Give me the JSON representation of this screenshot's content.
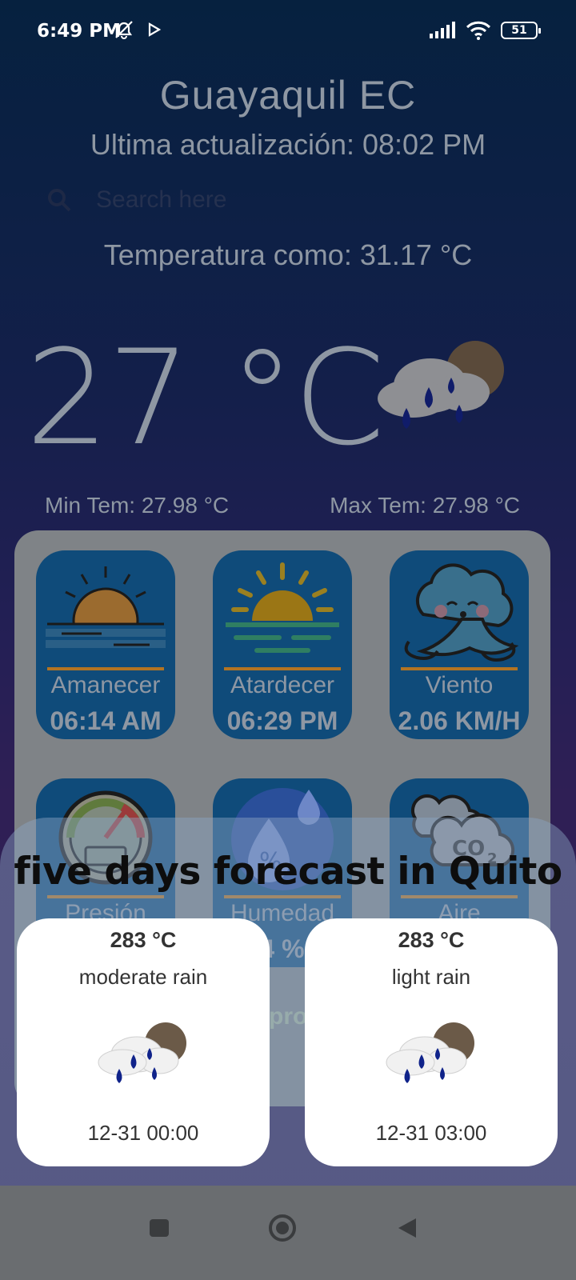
{
  "status": {
    "time": "6:49 PM",
    "battery": "51"
  },
  "weather": {
    "city": "Guayaquil EC",
    "last_update": "Ultima actualización: 08:02 PM",
    "feels_like": "Temperatura como: 31.17 °C",
    "temperature": "27 °C",
    "min_temp": "Min Tem: 27.98 °C",
    "max_temp": "Max Tem: 27.98 °C",
    "icon": "rain-cloud-moon-icon"
  },
  "search": {
    "placeholder": "Search here"
  },
  "tiles": [
    {
      "label": "Amanecer",
      "value": "06:14 AM",
      "icon": "sunrise-icon"
    },
    {
      "label": "Atardecer",
      "value": "06:29 PM",
      "icon": "sunset-icon"
    },
    {
      "label": "Viento",
      "value": "2.06 KM/H",
      "icon": "wind-cloud-icon"
    },
    {
      "label": "Presión",
      "value": "",
      "icon": "pressure-gauge-icon"
    },
    {
      "label": "Humedad",
      "value": "4 %",
      "icon": "humidity-icon"
    },
    {
      "label": "Aire",
      "value": "",
      "icon": "co2-cloud-icon"
    }
  ],
  "ghost": {
    "text": "pro"
  },
  "forecast": {
    "title": "five days forecast in Quito",
    "cards": [
      {
        "temp": "283 °C",
        "description": "moderate rain",
        "date": "12-31 00:00",
        "icon": "rain-cloud-moon-icon"
      },
      {
        "temp": "283 °C",
        "description": "light rain",
        "date": "12-31 03:00",
        "icon": "rain-cloud-moon-icon"
      }
    ]
  },
  "nav": {
    "buttons": [
      "recents-button",
      "home-button",
      "back-button"
    ]
  }
}
